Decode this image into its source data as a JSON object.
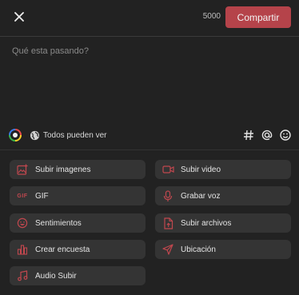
{
  "header": {
    "char_count": "5000",
    "share_label": "Compartir"
  },
  "composer": {
    "placeholder": "Qué esta pasando?"
  },
  "toolbar": {
    "audience_label": "Todos pueden ver",
    "icons": [
      "palette-icon",
      "globe-icon",
      "hashtag-icon",
      "mention-icon",
      "emoji-icon"
    ]
  },
  "options": [
    {
      "label": "Subir imagenes",
      "icon": "image-upload-icon"
    },
    {
      "label": "Subir video",
      "icon": "video-icon"
    },
    {
      "label": "GIF",
      "icon": "gif-icon"
    },
    {
      "label": "Grabar voz",
      "icon": "microphone-icon"
    },
    {
      "label": "Sentimientos",
      "icon": "smiley-icon"
    },
    {
      "label": "Subir archivos",
      "icon": "file-upload-icon"
    },
    {
      "label": "Crear encuesta",
      "icon": "poll-icon"
    },
    {
      "label": "Ubicación",
      "icon": "location-arrow-icon"
    },
    {
      "label": "Audio Subir",
      "icon": "music-icon"
    }
  ],
  "colors": {
    "accent": "#c0474e",
    "button": "#b5434a",
    "background": "#222222",
    "option_bg": "#343434"
  }
}
